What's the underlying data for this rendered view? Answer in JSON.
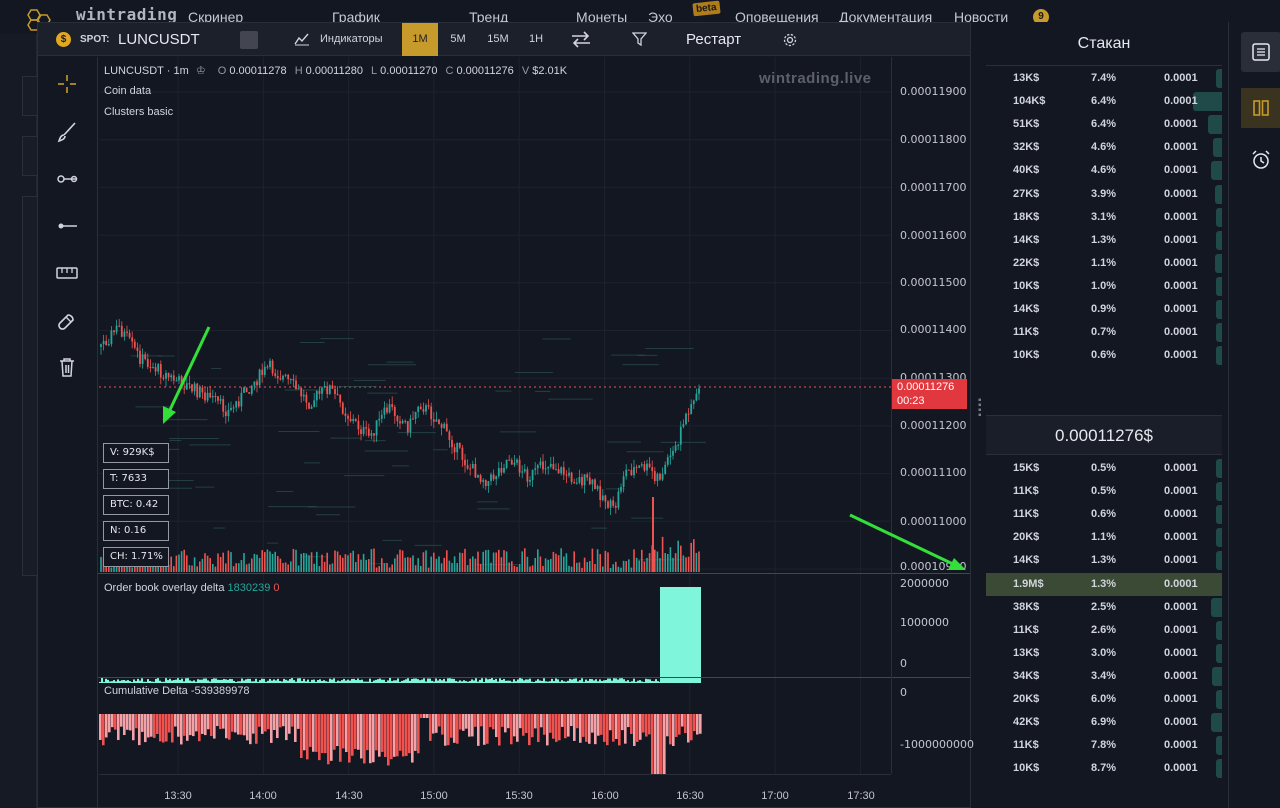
{
  "app": {
    "brand": "wintrading",
    "nav": [
      "Скринер",
      "График",
      "Тренд",
      "Монеты",
      "Эхо",
      "Оповещения",
      "Документация",
      "Новости"
    ],
    "beta_label": "beta",
    "notification_count": "9"
  },
  "toolbar": {
    "market_label": "SPOT:",
    "symbol": "LUNCUSDT",
    "indicators_label": "Индикаторы",
    "timeframes": [
      "1M",
      "5M",
      "15M",
      "1H"
    ],
    "active_timeframe": "1M",
    "restart_label": "Рестарт"
  },
  "chart": {
    "legend_symbol": "LUNCUSDT · 1m",
    "open_label": "O",
    "open": "0.00011278",
    "high_label": "H",
    "high": "0.00011280",
    "low_label": "L",
    "low": "0.00011270",
    "close_label": "C",
    "close": "0.00011276",
    "volume_label": "V",
    "volume": "$2.01K",
    "overlay_1": "Coin data",
    "overlay_2": "Clusters basic",
    "watermark": "wintrading.live",
    "info": [
      "V: 929K$",
      "T: 7633",
      "BTC: 0.42",
      "N: 0.16",
      "CH: 1.71%"
    ],
    "price_tag_value": "0.00011276",
    "price_tag_timer": "00:23",
    "price_axis": [
      "0.00011900",
      "0.00011800",
      "0.00011700",
      "0.00011600",
      "0.00011500",
      "0.00011400",
      "0.00011300",
      "0.00011200",
      "0.00011100",
      "0.00011000",
      "0.00010900"
    ],
    "time_axis": [
      "13:30",
      "14:00",
      "14:30",
      "15:00",
      "15:30",
      "16:00",
      "16:30",
      "17:00",
      "17:30"
    ],
    "obd_label": "Order book overlay delta",
    "obd_value": "1830239",
    "obd_value2": "0",
    "obd_axis": [
      "2000000",
      "1000000",
      "0"
    ],
    "cd_label": "Cumulative Delta",
    "cd_value": "-539389978",
    "cd_axis": [
      "0",
      "-1000000000"
    ],
    "colors": {
      "up": "#26a69a",
      "down": "#ef5350",
      "accent": "#c69a2b",
      "delta": "#7ff5dc"
    }
  },
  "orderbook": {
    "title": "Стакан",
    "asks": [
      {
        "size": "13K$",
        "pct": "7.4%",
        "price": "0.0001",
        "fill": 0.05
      },
      {
        "size": "104K$",
        "pct": "6.4%",
        "price": "0.0001",
        "fill": 0.35
      },
      {
        "size": "51K$",
        "pct": "6.4%",
        "price": "0.0001",
        "fill": 0.17
      },
      {
        "size": "32K$",
        "pct": "4.6%",
        "price": "0.0001",
        "fill": 0.11
      },
      {
        "size": "40K$",
        "pct": "4.6%",
        "price": "0.0001",
        "fill": 0.13
      },
      {
        "size": "27K$",
        "pct": "3.9%",
        "price": "0.0001",
        "fill": 0.09
      },
      {
        "size": "18K$",
        "pct": "3.1%",
        "price": "0.0001",
        "fill": 0.06
      },
      {
        "size": "14K$",
        "pct": "1.3%",
        "price": "0.0001",
        "fill": 0.05
      },
      {
        "size": "22K$",
        "pct": "1.1%",
        "price": "0.0001",
        "fill": 0.08
      },
      {
        "size": "10K$",
        "pct": "1.0%",
        "price": "0.0001",
        "fill": 0.03
      },
      {
        "size": "14K$",
        "pct": "0.9%",
        "price": "0.0001",
        "fill": 0.05
      },
      {
        "size": "11K$",
        "pct": "0.7%",
        "price": "0.0001",
        "fill": 0.04
      },
      {
        "size": "10K$",
        "pct": "0.6%",
        "price": "0.0001",
        "fill": 0.03
      }
    ],
    "mid_price": "0.00011276$",
    "bids": [
      {
        "size": "15K$",
        "pct": "0.5%",
        "price": "0.0001",
        "fill": 0.05
      },
      {
        "size": "11K$",
        "pct": "0.5%",
        "price": "0.0001",
        "fill": 0.04
      },
      {
        "size": "11K$",
        "pct": "0.6%",
        "price": "0.0001",
        "fill": 0.04
      },
      {
        "size": "20K$",
        "pct": "1.1%",
        "price": "0.0001",
        "fill": 0.07
      },
      {
        "size": "14K$",
        "pct": "1.3%",
        "price": "0.0001",
        "fill": 0.05
      },
      {
        "size": "1.9M$",
        "pct": "1.3%",
        "price": "0.0001",
        "fill": 1.0,
        "highlight": true
      },
      {
        "size": "38K$",
        "pct": "2.5%",
        "price": "0.0001",
        "fill": 0.13
      },
      {
        "size": "11K$",
        "pct": "2.6%",
        "price": "0.0001",
        "fill": 0.04
      },
      {
        "size": "13K$",
        "pct": "3.0%",
        "price": "0.0001",
        "fill": 0.05
      },
      {
        "size": "34K$",
        "pct": "3.4%",
        "price": "0.0001",
        "fill": 0.12
      },
      {
        "size": "20K$",
        "pct": "6.0%",
        "price": "0.0001",
        "fill": 0.07
      },
      {
        "size": "42K$",
        "pct": "6.9%",
        "price": "0.0001",
        "fill": 0.14
      },
      {
        "size": "11K$",
        "pct": "7.8%",
        "price": "0.0001",
        "fill": 0.04
      },
      {
        "size": "10K$",
        "pct": "8.7%",
        "price": "0.0001",
        "fill": 0.03
      }
    ]
  }
}
